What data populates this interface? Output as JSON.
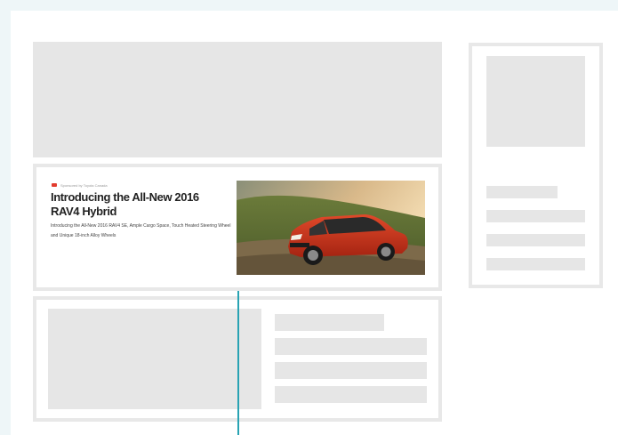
{
  "ad": {
    "sponsor": "Sponsored by Toyota Canada",
    "title": "Introducing the All-New 2016 RAV4 Hybrid",
    "description": "Introducing the All-New 2016 RAV4 SE, Ample Cargo Space, Touch Heated Steering Wheel and Unique 18-inch Alloy Wheels",
    "image_subject": "red-suv-image"
  },
  "colors": {
    "background": "#eef6f8",
    "placeholder": "#e6e6e6",
    "frame_border": "#e8e8e8",
    "indicator": "#29a3b3",
    "sponsor_dot": "#e23b2e"
  }
}
